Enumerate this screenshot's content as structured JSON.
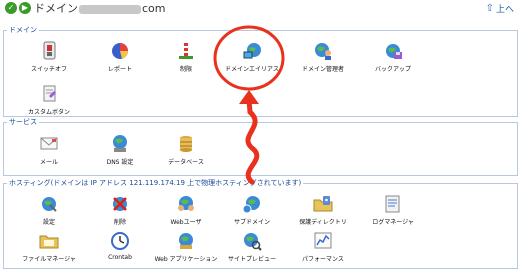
{
  "header": {
    "title_prefix": "ドメイン",
    "title_suffix": "com",
    "up_label": "上へ"
  },
  "sections": {
    "domain": {
      "title": "ドメイン",
      "items": [
        {
          "label": "スイッチオフ",
          "icon": "switch-off-icon"
        },
        {
          "label": "レポート",
          "icon": "report-icon"
        },
        {
          "label": "制限",
          "icon": "limit-icon"
        },
        {
          "label": "ドメインエイリアス",
          "icon": "domain-alias-icon"
        },
        {
          "label": "ドメイン管理者",
          "icon": "domain-admin-icon"
        },
        {
          "label": "バックアップ",
          "icon": "backup-icon"
        },
        {
          "label": "カスタムボタン",
          "icon": "custom-button-icon"
        }
      ]
    },
    "services": {
      "title": "サービス",
      "items": [
        {
          "label": "メール",
          "icon": "mail-icon"
        },
        {
          "label": "DNS 設定",
          "icon": "dns-icon"
        },
        {
          "label": "データベース",
          "icon": "database-icon"
        }
      ]
    },
    "hosting": {
      "title": "ホスティング(ドメインは IP アドレス 121.119.174.19 上で物理ホスティングされています)",
      "items": [
        {
          "label": "設定",
          "icon": "settings-icon"
        },
        {
          "label": "削除",
          "icon": "delete-icon"
        },
        {
          "label": "Webユーザ",
          "icon": "web-users-icon"
        },
        {
          "label": "サブドメイン",
          "icon": "subdomain-icon"
        },
        {
          "label": "保護ディレクトリ",
          "icon": "protected-directory-icon"
        },
        {
          "label": "ログマネージャ",
          "icon": "log-manager-icon"
        },
        {
          "label": "ファイルマネージャ",
          "icon": "file-manager-icon"
        },
        {
          "label": "Crontab",
          "icon": "crontab-icon"
        },
        {
          "label": "Web アプリケーション",
          "icon": "web-application-icon"
        },
        {
          "label": "サイトプレビュー",
          "icon": "site-preview-icon"
        },
        {
          "label": "パフォーマンス",
          "icon": "performance-icon"
        }
      ]
    }
  },
  "colors": {
    "section_border": "#b9c8de",
    "section_title": "#1a4a9a",
    "annotation": "#e8321e"
  }
}
